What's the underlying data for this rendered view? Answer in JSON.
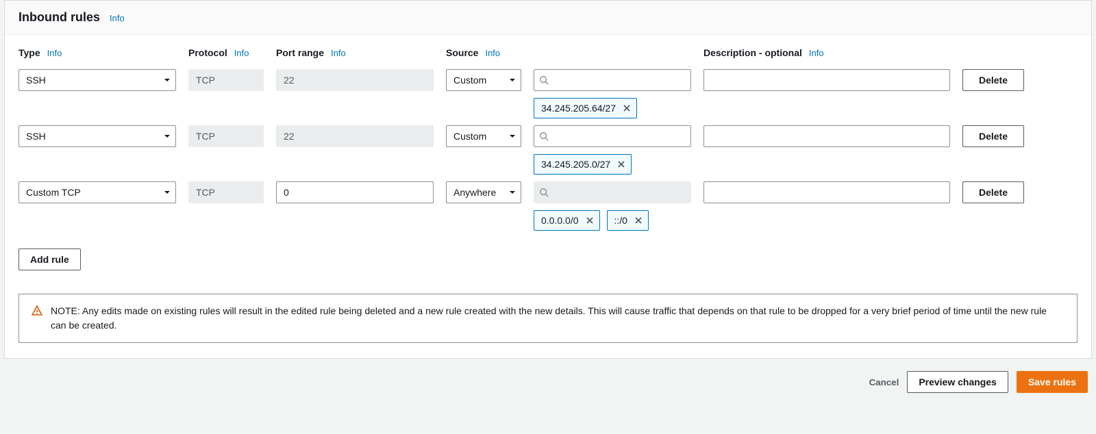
{
  "header": {
    "title": "Inbound rules",
    "info": "Info"
  },
  "columns": {
    "type": "Type",
    "protocol": "Protocol",
    "port_range": "Port range",
    "source": "Source",
    "description": "Description - optional",
    "info": "Info"
  },
  "rules": [
    {
      "type": "SSH",
      "protocol": "TCP",
      "port": "22",
      "port_editable": false,
      "source_mode": "Custom",
      "source_search_enabled": true,
      "source_chips": [
        "34.245.205.64/27"
      ],
      "description": ""
    },
    {
      "type": "SSH",
      "protocol": "TCP",
      "port": "22",
      "port_editable": false,
      "source_mode": "Custom",
      "source_search_enabled": true,
      "source_chips": [
        "34.245.205.0/27"
      ],
      "description": ""
    },
    {
      "type": "Custom TCP",
      "protocol": "TCP",
      "port": "0",
      "port_editable": true,
      "source_mode": "Anywhere",
      "source_search_enabled": false,
      "source_chips": [
        "0.0.0.0/0",
        "::/0"
      ],
      "description": ""
    }
  ],
  "buttons": {
    "delete": "Delete",
    "add_rule": "Add rule",
    "cancel": "Cancel",
    "preview": "Preview changes",
    "save": "Save rules"
  },
  "alert": {
    "text": "NOTE: Any edits made on existing rules will result in the edited rule being deleted and a new rule created with the new details. This will cause traffic that depends on that rule to be dropped for a very brief period of time until the new rule can be created."
  }
}
